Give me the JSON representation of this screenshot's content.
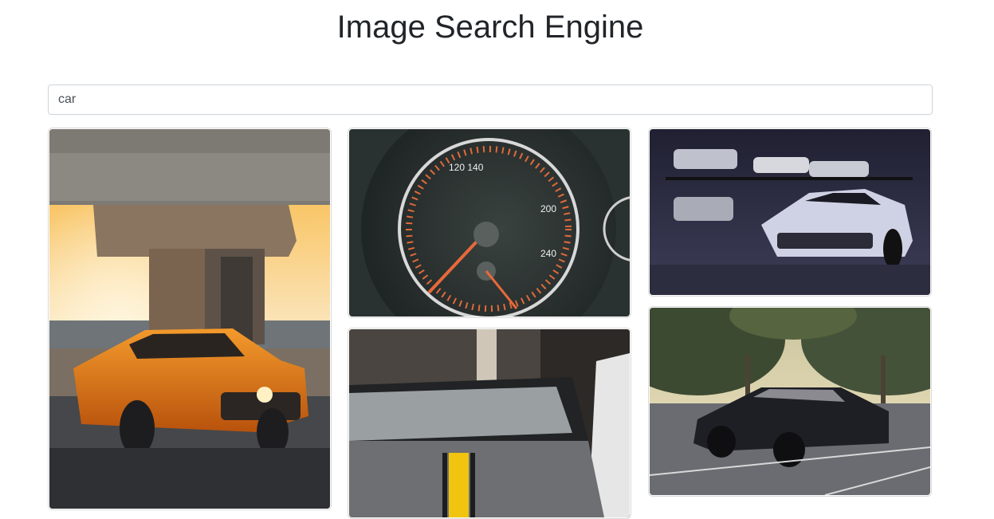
{
  "header": {
    "title": "Image Search Engine"
  },
  "search": {
    "value": "car"
  },
  "results": [
    {
      "subject": "orange-coupe-under-bridge"
    },
    {
      "subject": "speedometer-gauge"
    },
    {
      "subject": "grey-car-yellow-stripe"
    },
    {
      "subject": "white-sports-car-garage"
    },
    {
      "subject": "black-muscle-car-parking-lot"
    }
  ]
}
